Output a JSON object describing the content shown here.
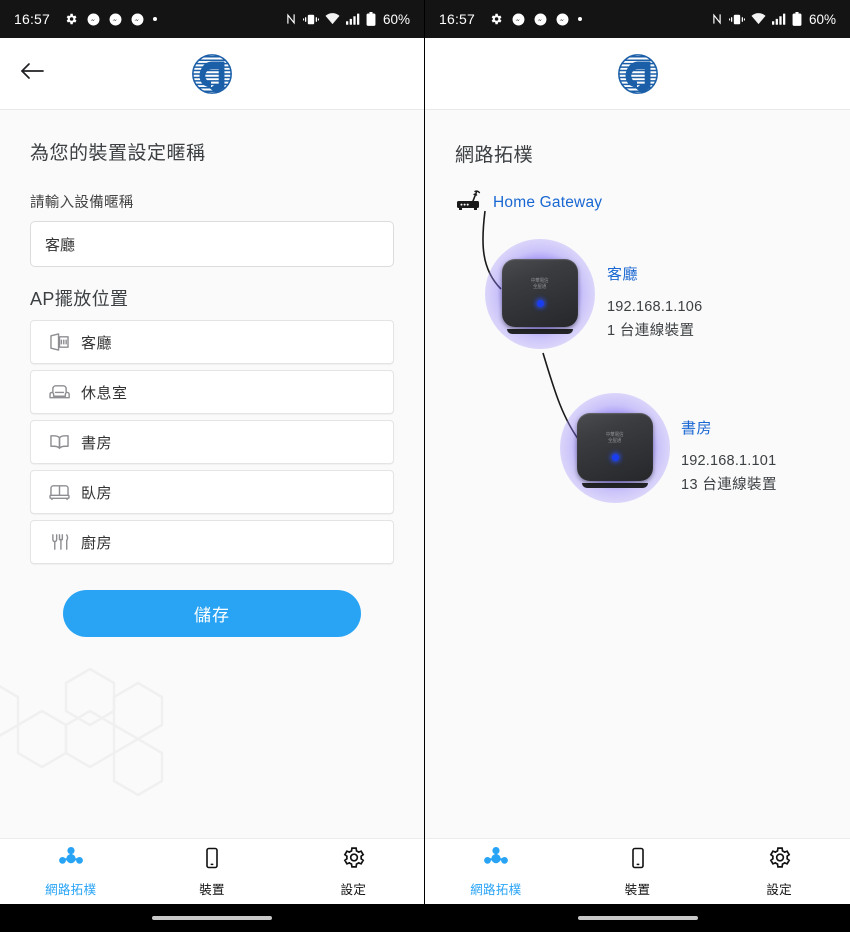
{
  "status_bar": {
    "clock": "16:57",
    "battery_text": "60%",
    "left_icons": [
      "gear-icon",
      "messenger-icon",
      "messenger-icon",
      "messenger-icon",
      "dot-icon"
    ],
    "right_icons": [
      "nfc-icon",
      "vibrate-icon",
      "wifi-icon",
      "signal-icon",
      "battery-icon"
    ]
  },
  "brand": {
    "logo_name": "chunghwa-telecom-logo",
    "accent_color": "#29a4f5",
    "link_color": "#1967d2",
    "logo_color": "#1b5fa8"
  },
  "left_screen": {
    "header": {
      "back_icon": "back-arrow-icon"
    },
    "page_title": "為您的裝置設定暱稱",
    "nickname_field": {
      "label": "請輸入設備暱稱",
      "value": "客廳",
      "placeholder": "請輸入設備暱稱"
    },
    "ap_section": {
      "title": "AP擺放位置",
      "items": [
        {
          "label": "客廳",
          "icon": "living-room-icon"
        },
        {
          "label": "休息室",
          "icon": "armchair-icon"
        },
        {
          "label": "書房",
          "icon": "book-icon"
        },
        {
          "label": "臥房",
          "icon": "bed-icon"
        },
        {
          "label": "廚房",
          "icon": "cutlery-icon"
        }
      ]
    },
    "save_button": "儲存"
  },
  "right_screen": {
    "page_title": "網路拓樸",
    "gateway": {
      "label": "Home Gateway",
      "icon": "router-icon"
    },
    "nodes": [
      {
        "name": "客廳",
        "ip": "192.168.1.106",
        "connected": "1 台連線裝置",
        "device_brand": "中華電信\n全屋通"
      },
      {
        "name": "書房",
        "ip": "192.168.1.101",
        "connected": "13 台連線裝置",
        "device_brand": "中華電信\n全屋通"
      }
    ]
  },
  "bottom_nav": {
    "items": [
      {
        "label": "網路拓樸",
        "icon": "topology-icon",
        "active": true
      },
      {
        "label": "裝置",
        "icon": "phone-icon",
        "active": false
      },
      {
        "label": "設定",
        "icon": "gear-icon",
        "active": false
      }
    ]
  }
}
